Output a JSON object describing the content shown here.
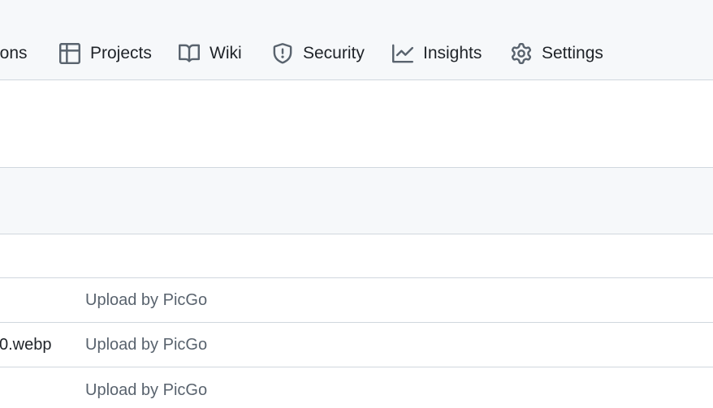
{
  "nav": {
    "items": [
      {
        "label": "ions",
        "icon": "actions-icon"
      },
      {
        "label": "Projects",
        "icon": "table-icon"
      },
      {
        "label": "Wiki",
        "icon": "book-icon"
      },
      {
        "label": "Security",
        "icon": "shield-icon"
      },
      {
        "label": "Insights",
        "icon": "graph-icon"
      },
      {
        "label": "Settings",
        "icon": "gear-icon"
      }
    ]
  },
  "files": {
    "rows": [
      {
        "name": "",
        "message": ""
      },
      {
        "name": "",
        "message": "Upload by PicGo"
      },
      {
        "name": "0.webp",
        "message": "Upload by PicGo"
      },
      {
        "name": "",
        "message": "Upload by PicGo"
      }
    ]
  },
  "colors": {
    "header_bg": "#f6f8fa",
    "border": "#d0d7de",
    "text": "#1f2328",
    "muted": "#59636e"
  }
}
